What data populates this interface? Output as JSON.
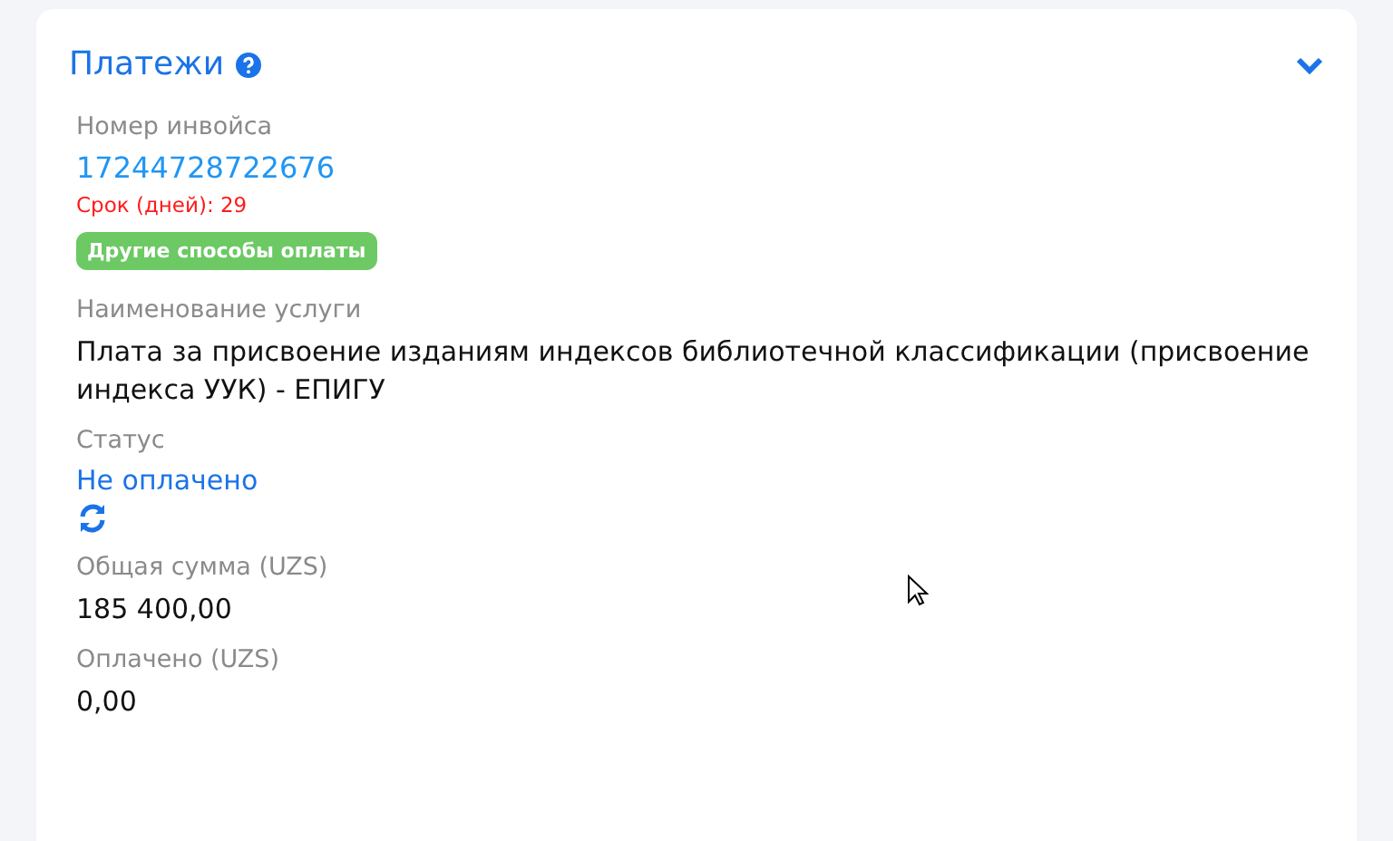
{
  "panel": {
    "title": "Платежи"
  },
  "invoice": {
    "label": "Номер инвойса",
    "number": "17244728722676",
    "deadline": "Срок (дней): 29",
    "other_methods_button": "Другие способы оплаты"
  },
  "service": {
    "label": "Наименование услуги",
    "value": "Плата за присвоение изданиям индексов библиотечной классификации (присвоение индекса УУК) - ЕПИГУ"
  },
  "status": {
    "label": "Статус",
    "value": "Не оплачено"
  },
  "fields": [
    {
      "label": "Общая сумма (UZS)",
      "value": "185 400,00"
    },
    {
      "label": "Оплачено (UZS)",
      "value": "0,00"
    }
  ]
}
